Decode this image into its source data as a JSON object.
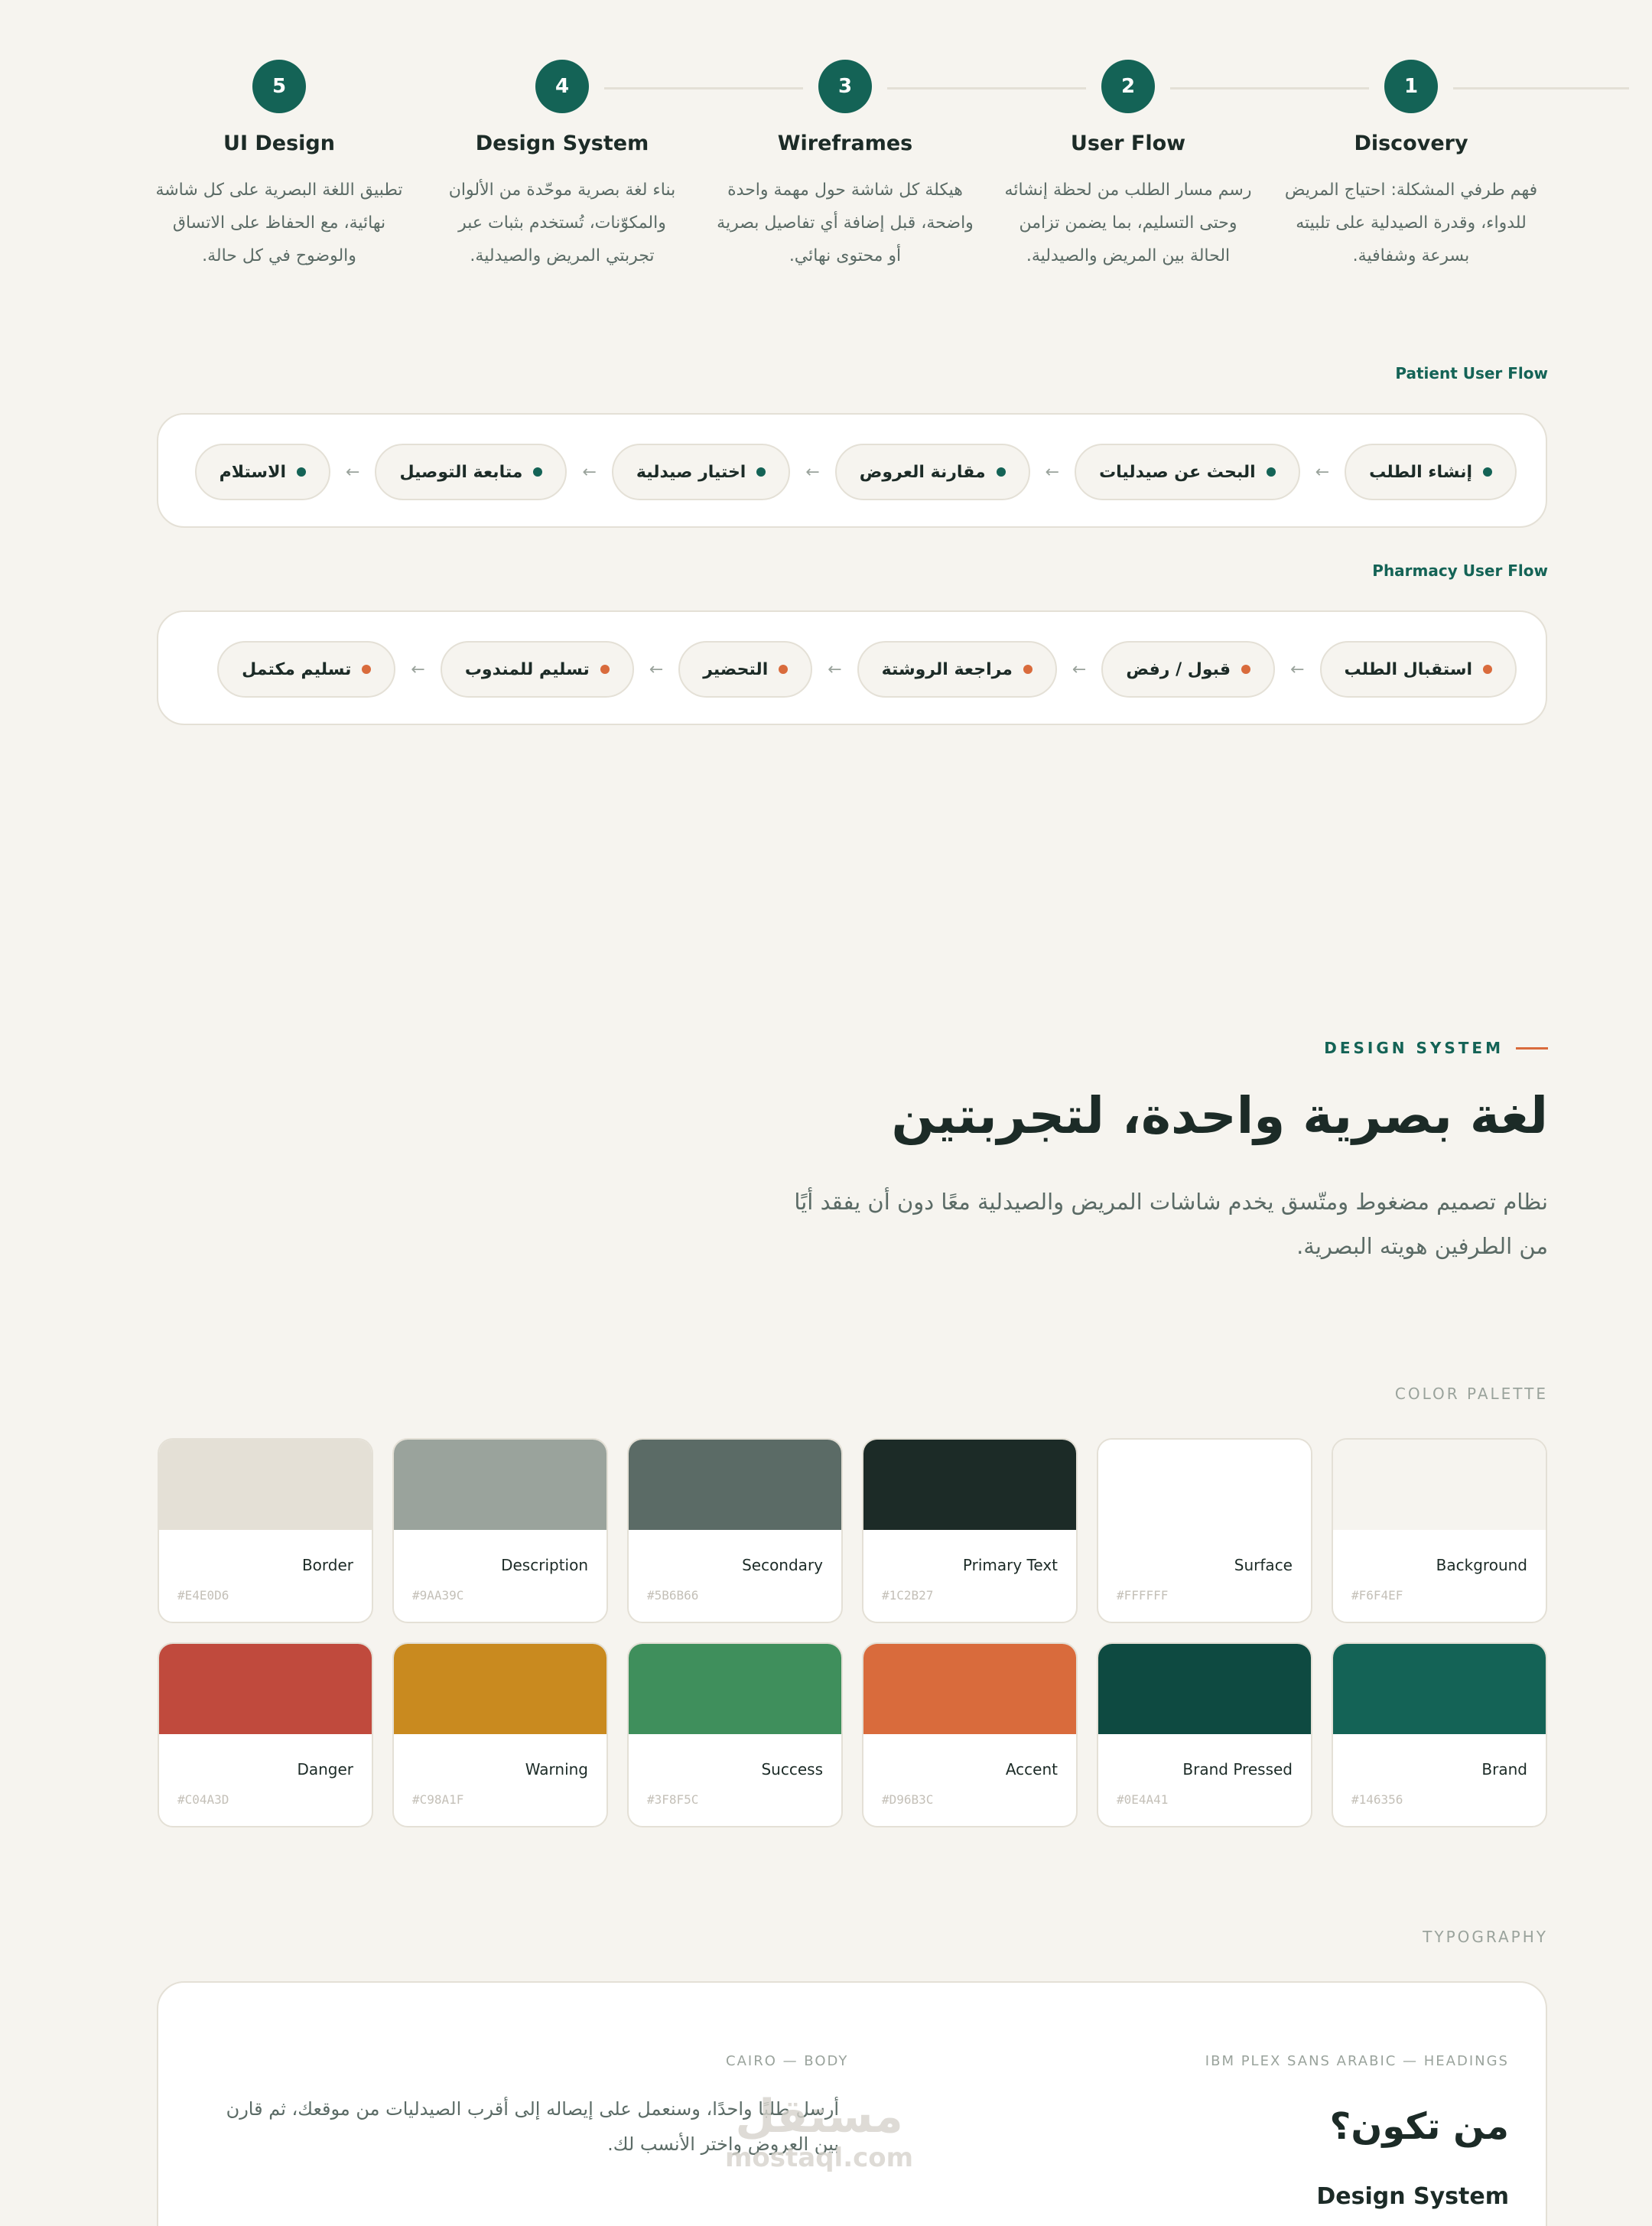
{
  "steps": [
    {
      "num": "1",
      "title": "Discovery",
      "desc": "فهم طرفي المشكلة: احتياج المريض للدواء، وقدرة الصيدلية على تلبيته بسرعة وشفافية."
    },
    {
      "num": "2",
      "title": "User Flow",
      "desc": "رسم مسار الطلب من لحظة إنشائه وحتى التسليم، بما يضمن تزامن الحالة بين المريض والصيدلية."
    },
    {
      "num": "3",
      "title": "Wireframes",
      "desc": "هيكلة كل شاشة حول مهمة واحدة واضحة، قبل إضافة أي تفاصيل بصرية أو محتوى نهائي."
    },
    {
      "num": "4",
      "title": "Design System",
      "desc": "بناء لغة بصرية موحّدة من الألوان والمكوّنات، تُستخدم بثبات عبر تجربتي المريض والصيدلية."
    },
    {
      "num": "5",
      "title": "UI Design",
      "desc": "تطبيق اللغة البصرية على كل شاشة نهائية، مع الحفاظ على الاتساق والوضوح في كل حالة."
    }
  ],
  "patient_flow": {
    "label": "Patient User Flow",
    "dot_color": "#146356",
    "arrow": "←",
    "items": [
      "إنشاء الطلب",
      "البحث عن صيدليات",
      "مقارنة العروض",
      "اختيار صيدلية",
      "متابعة التوصيل",
      "الاستلام"
    ]
  },
  "pharmacy_flow": {
    "label": "Pharmacy User Flow",
    "dot_color": "#D96B3C",
    "arrow": "←",
    "items": [
      "استقبال الطلب",
      "قبول / رفض",
      "مراجعة الروشتة",
      "التحضير",
      "تسليم للمندوب",
      "تسليم مكتمل"
    ]
  },
  "design_system": {
    "eyebrow": "DESIGN SYSTEM",
    "title": "لغة بصرية واحدة، لتجربتين",
    "subtitle": "نظام تصميم مضغوط ومتّسق يخدم شاشات المريض والصيدلية معًا دون أن يفقد أيًا من الطرفين هويته البصرية."
  },
  "palette": {
    "label": "COLOR PALETTE",
    "colors": [
      {
        "name": "Background",
        "hex": "#F6F4EF"
      },
      {
        "name": "Surface",
        "hex": "#FFFFFF"
      },
      {
        "name": "Primary Text",
        "hex": "#1C2B27"
      },
      {
        "name": "Secondary",
        "hex": "#5B6B66"
      },
      {
        "name": "Description",
        "hex": "#9AA39C"
      },
      {
        "name": "Border",
        "hex": "#E4E0D6"
      },
      {
        "name": "Brand",
        "hex": "#146356"
      },
      {
        "name": "Brand Pressed",
        "hex": "#0E4A41"
      },
      {
        "name": "Accent",
        "hex": "#D96B3C"
      },
      {
        "name": "Success",
        "hex": "#3F8F5C"
      },
      {
        "name": "Warning",
        "hex": "#C98A1F"
      },
      {
        "name": "Danger",
        "hex": "#C04A3D"
      }
    ]
  },
  "typography": {
    "label": "TYPOGRAPHY",
    "heading_label": "IBM PLEX SANS ARABIC — HEADINGS",
    "heading_sample": "من تكون؟",
    "heading_sample_en": "Design System",
    "body_label": "CAIRO — BODY",
    "body_sample": "أرسل طلبًا واحدًا، وسنعمل على إيصاله إلى أقرب الصيدليات من موقعك، ثم قارن بين العروض واختر الأنسب لك."
  },
  "watermark": {
    "ar": "مستقل",
    "en": "mostaql.com"
  }
}
